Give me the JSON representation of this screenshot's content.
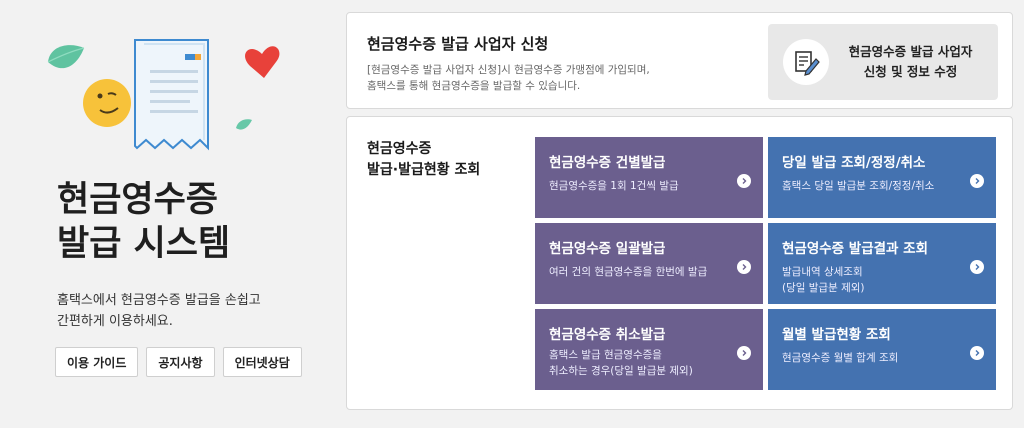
{
  "hero": {
    "title_line1": "현금영수증",
    "title_line2": "발급 시스템",
    "desc_line1": "홈택스에서 현금영수증 발급을 손쉽고",
    "desc_line2": "간편하게 이용하세요.",
    "buttons": [
      "이용 가이드",
      "공지사항",
      "인터넷상담"
    ]
  },
  "apply": {
    "title": "현금영수증 발급 사업자 신청",
    "desc_line1": "[현금영수증 발급 사업자 신청]시 현금영수증 가맹점에 가입되며,",
    "desc_line2": "홈택스를 통해 현금영수증을 발급할 수 있습니다.",
    "button_line1": "현금영수증 발급 사업자",
    "button_line2": "신청 및 정보 수정",
    "button_icon": "document-edit-icon"
  },
  "issue": {
    "title_line1": "현금영수증",
    "title_line2": "발급·발급현황 조회",
    "tiles": [
      {
        "title": "현금영수증 건별발급",
        "desc_line1": "현금영수증을 1회 1건씩 발급",
        "desc_line2": "",
        "icon": "chevron-right-icon"
      },
      {
        "title": "당일 발급 조회/정정/취소",
        "desc_line1": "홈택스 당일 발급분 조회/정정/취소",
        "desc_line2": "",
        "icon": "chevron-right-icon"
      },
      {
        "title": "현금영수증 일괄발급",
        "desc_line1": "여러 건의 현금영수증을 한번에 발급",
        "desc_line2": "",
        "icon": "chevron-right-icon"
      },
      {
        "title": "현금영수증 발급결과 조회",
        "desc_line1": "발급내역 상세조회",
        "desc_line2": "(당일 발급분 제외)",
        "icon": "chevron-right-icon"
      },
      {
        "title": "현금영수증 취소발급",
        "desc_line1": "홈택스 발급 현금영수증을",
        "desc_line2": "취소하는 경우(당일 발급분 제외)",
        "icon": "chevron-right-icon"
      },
      {
        "title": "월별 발급현황 조회",
        "desc_line1": "현금영수증 월별 합계 조회",
        "desc_line2": "",
        "icon": "chevron-right-icon"
      }
    ]
  },
  "colors": {
    "tile_purple": "#6b5f8e",
    "tile_blue": "#4472b0",
    "background": "#f2f2f2"
  }
}
